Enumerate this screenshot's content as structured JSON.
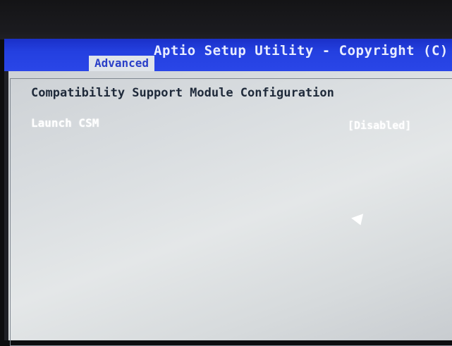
{
  "header": {
    "title": "Aptio Setup Utility - Copyright (C)",
    "active_tab": "Advanced"
  },
  "main": {
    "section_title": "Compatibility Support Module Configuration",
    "settings": [
      {
        "label": "Launch CSM",
        "value": "[Disabled]"
      }
    ]
  },
  "colors": {
    "title_bar": "#2440e0",
    "panel": "#d9dde0",
    "tab_bg": "#dfe4ea",
    "tab_text": "#2a3fc8"
  },
  "icons": {
    "cursor": "mouse-pointer-icon"
  }
}
